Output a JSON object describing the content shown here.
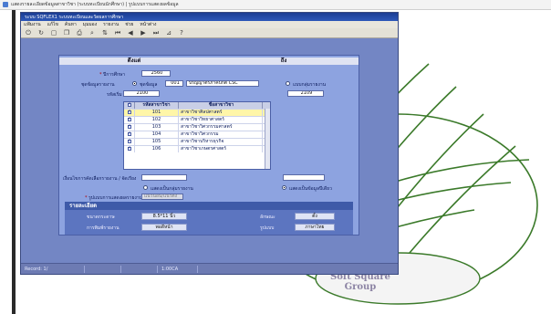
{
  "browser": {
    "title": "แสดงรายละเอียดข้อมูลสาขาวิชา (ระบบทะเบียนนักศึกษา) | รูปแบบการแสดงผลข้อมูล"
  },
  "app": {
    "title": "ระบบ SQFLEX1 ระบบทะเบียนและวัดผลการศึกษา",
    "menu": [
      "แฟ้มงาน",
      "แก้ไข",
      "ค้นหา",
      "มุมมอง",
      "รายงาน",
      "ช่วย",
      "หน้าต่าง"
    ],
    "toolbar_icons": [
      "exit-icon",
      "refresh-icon",
      "separator",
      "new-icon",
      "copy-icon",
      "print-icon",
      "search-icon",
      "sort-icon",
      "first-record-icon",
      "prev-record-icon",
      "next-record-icon",
      "last-record-icon",
      "filter-icon",
      "help-icon"
    ],
    "toolbar_help": "?"
  },
  "form": {
    "header_left": "ดึงแต่",
    "header_right": "ถึง",
    "year_label": "ปีการศึกษา",
    "year_value": "2560",
    "group_label": "ชุดข้อมูลรายงาน",
    "group_radio_label": "ชุดข้อมูล",
    "group_code": "001",
    "group_name": "ปริญญาตรีภาคปกติ CSC",
    "other_radio_label": "แบบกลุ่มรายงาน",
    "from_label": "รหัสเริ่ม",
    "from_value": "2100",
    "to_value": "2109",
    "table_headers": [
      "",
      "รหัสสาขาวิชา",
      "ชื่อสาขาวิชา"
    ],
    "table_rows": [
      {
        "checked": true,
        "code": "101",
        "name": "สาขาวิชาศิลปศาสตร์",
        "selected": true
      },
      {
        "checked": true,
        "code": "102",
        "name": "สาขาวิชาวิทยาศาสตร์",
        "selected": false
      },
      {
        "checked": true,
        "code": "103",
        "name": "สาขาวิชาวิศวกรรมศาสตร์",
        "selected": false
      },
      {
        "checked": true,
        "code": "104",
        "name": "สาขาวิชาวิศวกรรม",
        "selected": false
      },
      {
        "checked": true,
        "code": "105",
        "name": "สาขาวิชาบริหารธุรกิจ",
        "selected": false
      },
      {
        "checked": true,
        "code": "106",
        "name": "สาขาวิชาเกษตรศาสตร์",
        "selected": false
      }
    ],
    "condition_label": "เงื่อนไขการคัดเลือกรายงาน / จัดเรียง",
    "radio_a_label": "แสดงเป็นกลุ่มรายงาน",
    "radio_b_label": "แสดงเป็นข้อมูลปีเดียว",
    "format_label": "รูปแบบการแสดงผลรายงาน",
    "format_value": "แนวนอน/แนวตั้ง"
  },
  "details": {
    "title": "รายละเอียด",
    "paper_label": "ขนาดกระดาษ",
    "paper_value": "8.5*11 นิ้ว",
    "orientation_label": "ลักษณะ",
    "orientation_value": "ตั้ง",
    "print_label": "การพิมพ์รายงาน",
    "print_value": "พอดีหน้า",
    "font_label": "รูปแบบ",
    "font_value": "ภาษาไทย"
  },
  "status": {
    "record": "Record: 1/",
    "extra": "1:00CA"
  },
  "logo": {
    "line1": "Soft Square",
    "line2": "Group"
  },
  "colors": {
    "window": "#6f7fb7",
    "form": "#8da3e0",
    "selected_row": "#fff6a8",
    "title_bar": "#1b3d93"
  }
}
